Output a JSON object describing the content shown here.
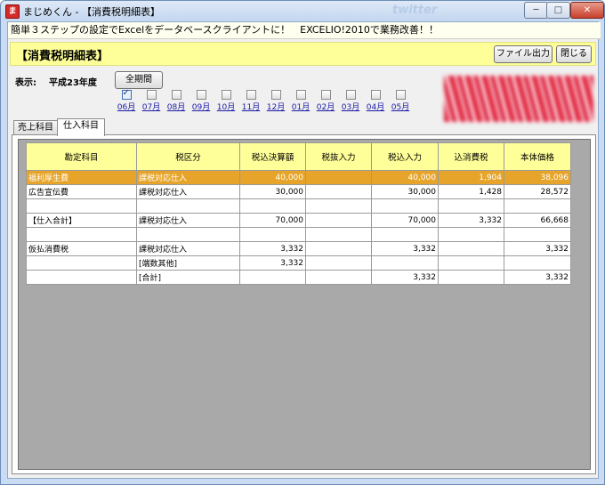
{
  "window": {
    "app_icon": "ま",
    "title": "まじめくん - 【消費税明細表】",
    "background_brand": "twitter",
    "controls": {
      "minimize": "─",
      "maximize": "□",
      "close": "✕"
    }
  },
  "promo_text": "簡単３ステップの設定でExcelをデータベースクライアントに！　EXCELIO!2010で業務改善！！",
  "header": {
    "title": "【消費税明細表】",
    "file_output_label": "ファイル出力",
    "close_label": "閉じる"
  },
  "filter": {
    "display_label": "表示:",
    "period": "平成23年度",
    "all_period_label": "全期間",
    "months": [
      {
        "label": "06月",
        "checked": true
      },
      {
        "label": "07月",
        "checked": false
      },
      {
        "label": "08月",
        "checked": false
      },
      {
        "label": "09月",
        "checked": false
      },
      {
        "label": "10月",
        "checked": false
      },
      {
        "label": "11月",
        "checked": false
      },
      {
        "label": "12月",
        "checked": false
      },
      {
        "label": "01月",
        "checked": false
      },
      {
        "label": "02月",
        "checked": false
      },
      {
        "label": "03月",
        "checked": false
      },
      {
        "label": "04月",
        "checked": false
      },
      {
        "label": "05月",
        "checked": false
      }
    ]
  },
  "tabs": [
    {
      "label": "売上科目",
      "active": false
    },
    {
      "label": "仕入科目",
      "active": true
    }
  ],
  "table": {
    "columns": [
      "勘定科目",
      "税区分",
      "税込決算額",
      "税抜入力",
      "税込入力",
      "込消費税",
      "本体価格"
    ],
    "rows": [
      {
        "cells": [
          "福利厚生費",
          "課税対応仕入",
          "40,000",
          "",
          "40,000",
          "1,904",
          "38,096"
        ],
        "selected": true
      },
      {
        "cells": [
          "広告宣伝費",
          "課税対応仕入",
          "30,000",
          "",
          "30,000",
          "1,428",
          "28,572"
        ],
        "selected": false
      },
      {
        "cells": [
          "",
          "",
          "",
          "",
          "",
          "",
          ""
        ],
        "selected": false
      },
      {
        "cells": [
          "【仕入合計】",
          "課税対応仕入",
          "70,000",
          "",
          "70,000",
          "3,332",
          "66,668"
        ],
        "selected": false
      },
      {
        "cells": [
          "",
          "",
          "",
          "",
          "",
          "",
          ""
        ],
        "selected": false
      },
      {
        "cells": [
          "仮払消費税",
          "課税対応仕入",
          "3,332",
          "",
          "3,332",
          "",
          "3,332"
        ],
        "selected": false
      },
      {
        "cells": [
          "",
          "[端数其他]",
          "3,332",
          "",
          "",
          "",
          ""
        ],
        "selected": false
      },
      {
        "cells": [
          "",
          "[合計]",
          "",
          "",
          "3,332",
          "",
          "3,332"
        ],
        "selected": false
      }
    ]
  },
  "colors": {
    "header_band": "#ffff99",
    "selected_row": "#e6a52a",
    "grid_background": "#a9a9a9",
    "month_link": "#1a1aa6"
  }
}
